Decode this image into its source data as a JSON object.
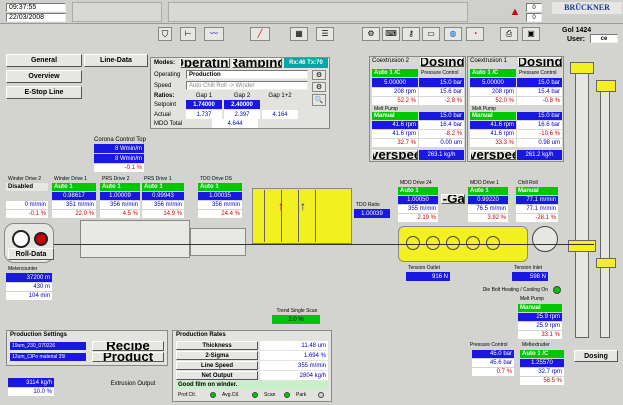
{
  "header": {
    "time": "09:37:55",
    "date": "22/03/2008",
    "counter_top": "0",
    "counter_bottom": "0",
    "brand": "BRÜCKNER",
    "line_name": "Gol 1424",
    "user_label": "User:",
    "user_value": "ce"
  },
  "nav": {
    "general": "General",
    "overview": "Overview",
    "estop": "E-Stop Line",
    "line_data": "Line-Data"
  },
  "modes": {
    "label": "Modes:",
    "operating": "Operating",
    "ramping": "Ramping",
    "rx": "Rx:46 Tx:70",
    "operating_label": "Operating",
    "operating_value": "Production",
    "speed_label": "Speed",
    "speed_value": "Auto Chill Roll -> Winder",
    "ratios_label": "Ratios:",
    "gap1": "Gap 1",
    "gap2": "Gap 2",
    "gap12": "Gap 1+2",
    "setpoint_label": "Setpoint",
    "setpoint1": "1.74000",
    "setpoint2": "2.40000",
    "actual_label": "Actual",
    "actual1": "1.737",
    "actual2": "2.397",
    "actual12": "4.164",
    "mdo_total_label": "MDO Total",
    "mdo_total": "4.644"
  },
  "corona_bot": {
    "title": "Coextrusion 2",
    "dosing": "Dosing",
    "mode": "Auto 1 /C",
    "set": "5.00000",
    "rpm": "208 rpm",
    "pct": "52.2 %",
    "pc": "Pressure Control",
    "bar": "15.0 bar",
    "bar2": "15.6 bar",
    "dev": "-2.8 %",
    "mp": "Melt Pump",
    "manual": "Manual",
    "rpm2": "41.6 rpm",
    "rpm3": "41.6 rpm",
    "pct2": "32.7 %",
    "bar3": "15.0 bar",
    "bar4": "16.4 bar",
    "dev2": "-8.2 %",
    "thk": "0.00 um",
    "out": "263.1 kg/h",
    "overspeed": "Overspeed"
  },
  "coex1": {
    "title": "Coextrusion 1",
    "dosing": "Dosing",
    "mode": "Auto 1 /C",
    "set": "5.00000",
    "rpm": "208 rpm",
    "pct": "52.0 %",
    "pc": "Pressure Control",
    "bar": "15.0 bar",
    "bar2": "15.4 bar",
    "dev": "-0.8 %",
    "mp": "Melt Pump",
    "manual": "Manual",
    "rpm2": "41.6 rpm",
    "rpm3": "41.6 rpm",
    "pct2": "33.3 %",
    "bar3": "15.0 bar",
    "bar4": "16.6 bar",
    "dev2": "-10.6 %",
    "thk": "0.98 um",
    "out": "261.2 kg/h",
    "overspeed": "Overspeed"
  },
  "corona_top": {
    "title": "Corona Control Top",
    "v1": "8 Wmin/m",
    "v2": "8 Wmin/m",
    "v3": "-0.1 %"
  },
  "winder2": {
    "title": "Winder Drive 2",
    "mode": "Disabled",
    "speed": "0 m/min",
    "pct": "-0.1 %"
  },
  "winder1": {
    "title": "Winder Drive 1",
    "mode": "Auto 1",
    "set": "0.98617",
    "speed": "351 m/min",
    "pct": "22.0 %"
  },
  "prs2": {
    "title": "PRS Drive 2",
    "mode": "Auto 1",
    "set": "1.00009",
    "speed": "356 m/min",
    "pct": "4.5 %"
  },
  "prs1": {
    "title": "PRS Drive 1",
    "mode": "Auto 1",
    "set": "0.99943",
    "speed": "356 m/min",
    "pct": "14.9 %"
  },
  "tdo_ds": {
    "title": "TDO Drive DS",
    "mode": "Auto 1",
    "set": "1.00035",
    "speed": "356 m/min",
    "pct": "24.4 %"
  },
  "tdo_ratio": {
    "title": "TDO Ratio",
    "value": "1.00039"
  },
  "mdo2": {
    "title": "MDO Drive 24",
    "mode": "Auto 1",
    "set": "1.00050",
    "speed": "355 m/min",
    "pct": "2.19 %"
  },
  "mdo1": {
    "title": "MDO Drive 1",
    "mode": "Auto 1",
    "set": "0.99220",
    "speed": "76.5 m/min",
    "pct": "3.92 %"
  },
  "chill": {
    "title": "Chill Roll",
    "manual": "Manual",
    "speed1": "77.1 m/min",
    "speed2": "77.1 m/min",
    "pct": "-28.1 %"
  },
  "cgap": "C-Gap",
  "roll_data": "Roll-Data",
  "metercounter": {
    "title": "Metercounter",
    "v1": "37200 m",
    "v2": "430 m",
    "v3": "104 min"
  },
  "tension1": {
    "title": "Tension Outlet",
    "value": "916 N"
  },
  "tension2": {
    "title": "Tension Inlet",
    "value": "598 N"
  },
  "die": "Die Bolt Heating / Cooling On",
  "trend": {
    "title": "Trend Single Scan",
    "value": "2.0 %"
  },
  "prod_settings": {
    "title": "Production Settings",
    "item1": "19um_230_070226",
    "item2": "12um_ClPo material 35l",
    "recipe": "Recipe",
    "product": "Product"
  },
  "prod_rates": {
    "title": "Production Rates",
    "thickness_label": "Thickness",
    "thickness": "11.48 um",
    "sigma_label": "2-Sigma",
    "sigma": "1.694 %",
    "linespeed_label": "Line Speed",
    "linespeed": "355 m/min",
    "netout_label": "Net Output",
    "netout": "2804 kg/h",
    "status": "Good film on winder.",
    "ind1": "Prof.Ctl.",
    "ind2": "Avg.Ctl.",
    "ind3": "Scan",
    "ind4": "Park"
  },
  "extrusion": {
    "v1": "3114 kg/h",
    "v2": "10.0 %",
    "label": "Extrusion Output"
  },
  "melt_pump": {
    "title": "Melt Pump",
    "manual": "Manual",
    "rpm1": "25.9 rpm",
    "rpm2": "25.9 rpm",
    "pct": "33.1 %"
  },
  "pressure": {
    "title": "Pressure Control",
    "bar1": "45.0 bar",
    "bar2": "45.6 bar",
    "pct": "0.7 %"
  },
  "meltextruder": {
    "title": "Meltextruder",
    "mode": "Auto 1 /C",
    "set": "1.25570",
    "rpm": "32.7 rpm",
    "pct": "58.5 %"
  },
  "dosing_main": "Dosing"
}
